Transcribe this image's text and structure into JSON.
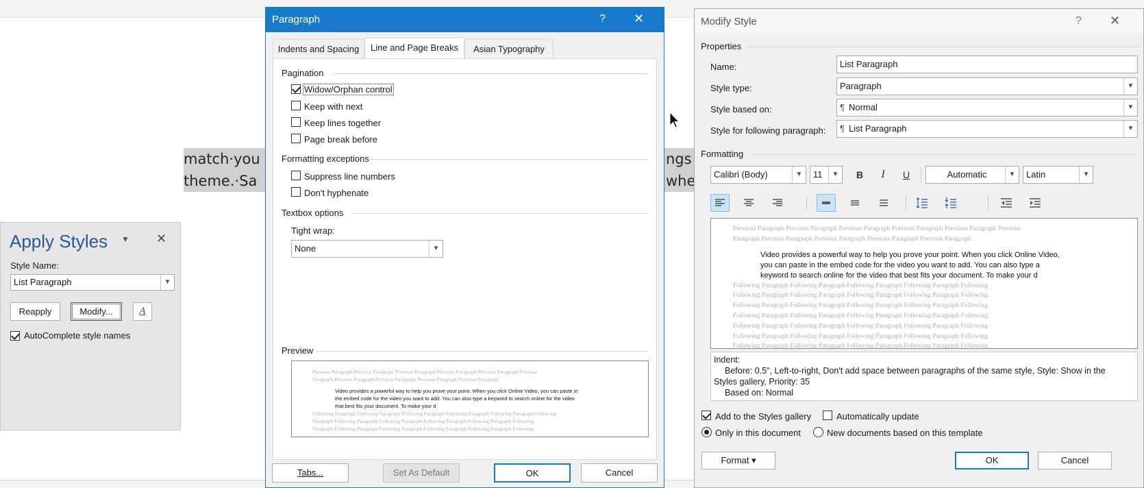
{
  "document": {
    "line1": "match·you",
    "line1_right": "ngs",
    "line2": "theme.·Sa",
    "line2_right": "whe"
  },
  "apply_styles": {
    "title": "Apply Styles",
    "style_name_label": "Style Name:",
    "style_name_value": "List Paragraph",
    "reapply": "Reapply",
    "modify": "Modify...",
    "autocomplete": "AutoComplete style names",
    "autocomplete_checked": true
  },
  "paragraph": {
    "title": "Paragraph",
    "help": "?",
    "close": "✕",
    "tabs": [
      "Indents and Spacing",
      "Line and Page Breaks",
      "Asian Typography"
    ],
    "active_tab": 1,
    "pagination_label": "Pagination",
    "pagination": [
      {
        "label": "Widow/Orphan control",
        "checked": true
      },
      {
        "label": "Keep with next",
        "checked": false
      },
      {
        "label": "Keep lines together",
        "checked": false
      },
      {
        "label": "Page break before",
        "checked": false
      }
    ],
    "exceptions_label": "Formatting exceptions",
    "exceptions": [
      {
        "label": "Suppress line numbers",
        "checked": false
      },
      {
        "label": "Don't hyphenate",
        "checked": false
      }
    ],
    "textbox_label": "Textbox options",
    "tight_wrap_label": "Tight wrap:",
    "tight_wrap_value": "None",
    "preview_label": "Preview",
    "preview": {
      "prev": [
        "Previous Paragraph Previous Paragraph Previous Paragraph Previous Paragraph Previous Paragraph Previous",
        "Paragraph Previous Paragraph Previous Paragraph Previous Paragraph Previous Paragraph"
      ],
      "main": [
        "Video provides a powerful way to help you prove your point. When you click Online Video, you can paste in",
        "the embed code for the video you want to add. You can also type a keyword to search online for the video",
        "that best fits your document. To make your d"
      ],
      "next": [
        "Following Paragraph Following Paragraph Following Paragraph Following Paragraph Following Paragraph Following",
        "Paragraph Following Paragraph Following Paragraph Following Paragraph Following Paragraph Following",
        "Paragraph Following Paragraph Following Paragraph Following Paragraph Following Paragraph Following"
      ]
    },
    "buttons": {
      "tabs": "Tabs...",
      "set_default": "Set As Default",
      "ok": "OK",
      "cancel": "Cancel"
    }
  },
  "modify_style": {
    "title": "Modify Style",
    "help": "?",
    "close": "✕",
    "properties_label": "Properties",
    "name_label": "Name:",
    "name_value": "List Paragraph",
    "style_type_label": "Style type:",
    "style_type_value": "Paragraph",
    "based_on_label": "Style based on:",
    "based_on_value": "Normal",
    "following_label": "Style for following paragraph:",
    "following_value": "List Paragraph",
    "formatting_label": "Formatting",
    "font": "Calibri (Body)",
    "size": "11",
    "bold": "B",
    "italic": "I",
    "underline": "U",
    "color": "Automatic",
    "script": "Latin",
    "preview": {
      "prev": [
        "Previous Paragraph Previous Paragraph Previous Paragraph Previous Paragraph Previous Paragraph Previous",
        "Paragraph Previous Paragraph Previous Paragraph Previous Paragraph Previous Paragraph"
      ],
      "main": [
        "Video provides a powerful way to help you prove your point. When you click Online Video,",
        "you can paste in the embed code for the video you want to add. You can also type a",
        "keyword to search online for the video that best fits your document. To make your d"
      ],
      "next": [
        "Following Paragraph Following Paragraph Following Paragraph Following Paragraph Following",
        "Following Paragraph Following Paragraph Following Paragraph Following Paragraph Following",
        "Following Paragraph Following Paragraph Following Paragraph Following Paragraph Following",
        "Following Paragraph Following Paragraph Following Paragraph Following Paragraph Following",
        "Following Paragraph Following Paragraph Following Paragraph Following Paragraph Following",
        "Following Paragraph Following Paragraph Following Paragraph Following Paragraph Following",
        "Following Paragraph Following Paragraph Following Paragraph Following Paragraph Following"
      ]
    },
    "description": [
      "Indent:",
      "Before:  0.5\", Left-to-right, Don't add space between paragraphs of the same style, Style: Show in the",
      "Styles gallery, Priority: 35",
      "Based on: Normal"
    ],
    "add_gallery": "Add to the Styles gallery",
    "add_gallery_checked": true,
    "auto_update": "Automatically update",
    "auto_update_checked": false,
    "only_doc": "Only in this document",
    "new_docs": "New documents based on this template",
    "only_doc_selected": true,
    "format_btn": "Format ▾",
    "ok": "OK",
    "cancel": "Cancel"
  },
  "colors": {
    "accent": "#1979ca",
    "pane_title": "#2b579a"
  }
}
